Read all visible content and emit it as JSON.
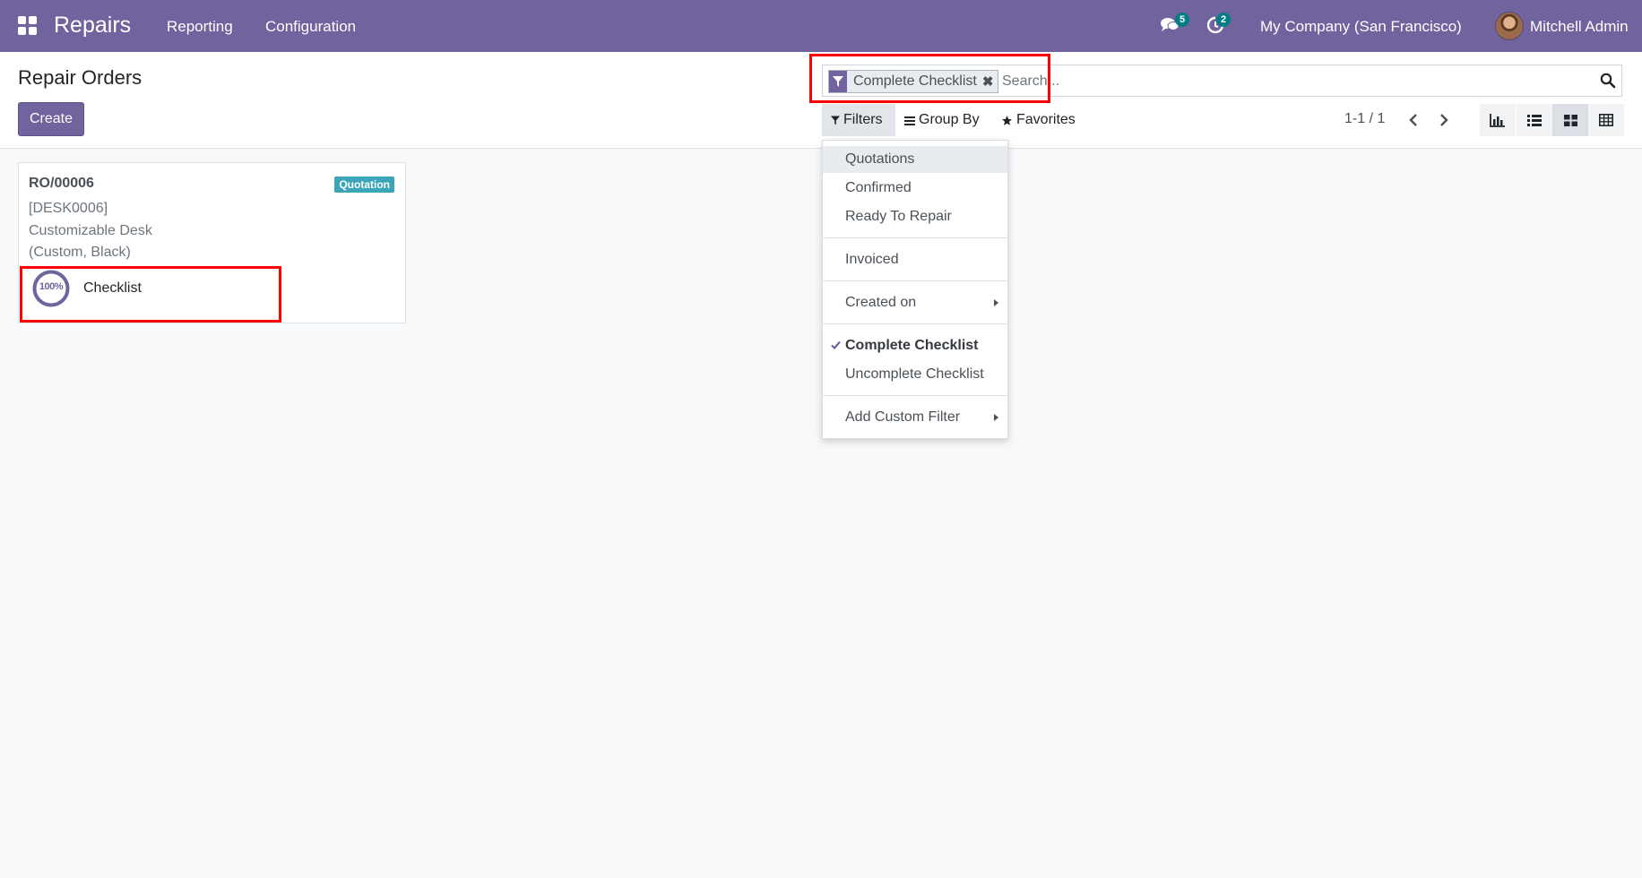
{
  "navbar": {
    "app_name": "Repairs",
    "menu": [
      "Reporting",
      "Configuration"
    ],
    "messages_count": "5",
    "activities_count": "2",
    "company": "My Company (San Francisco)",
    "user": "Mitchell Admin"
  },
  "control_panel": {
    "title": "Repair Orders",
    "create_label": "Create",
    "search": {
      "facet": "Complete Checklist",
      "remove_glyph": "✖",
      "placeholder": "Search..."
    },
    "filters_label": "Filters",
    "group_by_label": "Group By",
    "favorites_label": "Favorites",
    "pager": "1-1 / 1",
    "views": [
      "graph-view",
      "list-view",
      "kanban-view",
      "pivot-view"
    ],
    "active_view": "kanban-view"
  },
  "card": {
    "reference": "RO/00006",
    "status_tag": "Quotation",
    "product_code": "[DESK0006]",
    "product_name": "Customizable Desk",
    "product_variant": "(Custom, Black)",
    "progress_label": "100%",
    "progress_value": 1.0,
    "checklist_label": "Checklist"
  },
  "filter_menu": {
    "items": [
      "Quotations",
      "Confirmed",
      "Ready To Repair",
      "Invoiced",
      "Created on",
      "Complete Checklist",
      "Uncomplete Checklist",
      "Add Custom Filter"
    ],
    "selected": "Complete Checklist"
  },
  "colors": {
    "primary": "#71639e",
    "badge": "#017e84",
    "tag": "#3da5b8",
    "highlight": "#ff0000"
  }
}
